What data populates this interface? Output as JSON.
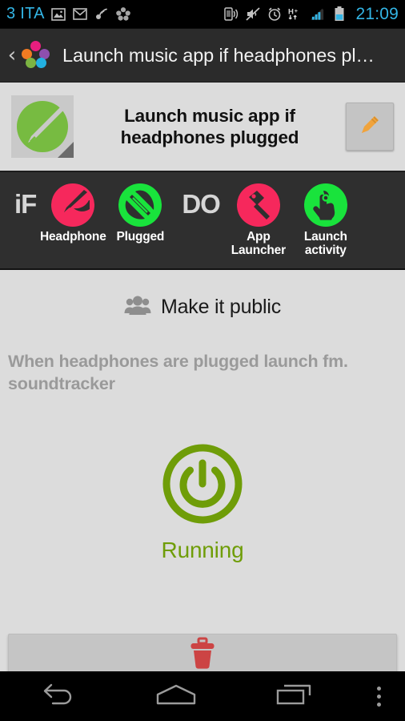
{
  "status_bar": {
    "carrier": "3 ITA",
    "clock": "21:09",
    "left_icons": [
      "gallery-icon",
      "gmail-icon",
      "sync-icon",
      "atooma-icon"
    ],
    "right_icons": [
      "vibrate-icon",
      "mute-icon",
      "alarm-icon",
      "hplus-data-icon",
      "signal-bars-icon",
      "battery-icon"
    ],
    "accent_color": "#33b5e5"
  },
  "action_bar": {
    "back_label": "‹",
    "title": "Launch music app if headphones pl…",
    "logo_name": "atooma-logo",
    "logo_colors": [
      "#e81e7f",
      "#f07b22",
      "#8e4fae",
      "#7cb342",
      "#22b0e0"
    ]
  },
  "header_card": {
    "icon_name": "paintbrush-recipe-icon",
    "icon_color": "#77bb41",
    "title": "Launch music app if\nheadphones plugged",
    "title_line1": "Launch music app if",
    "title_line2": "headphones plugged",
    "edit_button_label": "edit",
    "edit_icon_color": "#f0a33c"
  },
  "recipe_strip": {
    "if_label": "iF",
    "do_label": "DO",
    "if_nodes": [
      {
        "label": "Headphone",
        "icon": "headphone-icon",
        "color": "#f6285c"
      },
      {
        "label": "Plugged",
        "icon": "plug-icon",
        "color": "#19e33c"
      }
    ],
    "do_nodes": [
      {
        "label": "App\nLauncher",
        "label_line1": "App",
        "label_line2": "Launcher",
        "icon": "rocket-launcher-icon",
        "color": "#f6285c"
      },
      {
        "label": "Launch\nactivity",
        "label_line1": "Launch",
        "label_line2": "activity",
        "icon": "tap-hand-icon",
        "color": "#19e33c"
      }
    ]
  },
  "main": {
    "public_label": "Make it public",
    "public_icon": "people-group-icon",
    "description": "When headphones are plugged launch fm. soundtracker",
    "status_label": "Running",
    "status_color": "#6f9d08",
    "power_icon": "power-button-icon",
    "delete_icon": "trash-icon",
    "delete_color": "#cc4444"
  },
  "nav_bar": {
    "back": "back-icon",
    "home": "home-icon",
    "recents": "recents-icon",
    "overflow": "overflow-menu-icon"
  }
}
